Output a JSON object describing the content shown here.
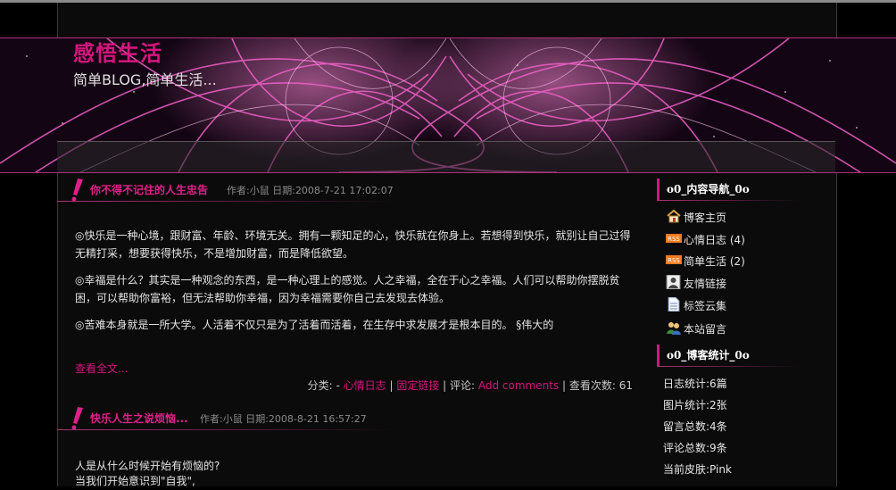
{
  "site": {
    "title": "感悟生活",
    "subtitle": "简单BLOG,简单生活..."
  },
  "posts": [
    {
      "title": "你不得不记住的人生忠告",
      "meta": "作者:小鼠 日期:2008-7-21 17:02:07",
      "paragraphs": [
        "◎快乐是一种心境，跟财富、年龄、环境无关。拥有一颗知足的心，快乐就在你身上。若想得到快乐，就别让自己过得无精打采，想要获得快乐，不是增加财富，而是降低欲望。",
        "◎幸福是什么？其实是一种观念的东西，是一种心理上的感觉。人之幸福，全在于心之幸福。人们可以帮助你摆脱贫困，可以帮助你富裕，但无法帮助你幸福，因为幸福需要你自己去发现去体验。",
        " ◎苦难本身就是一所大学。人活着不仅只是为了活着而活着，在生存中求发展才是根本目的。 §伟大的"
      ],
      "read_more": "查看全文...",
      "footer": {
        "category_label": "分类: - ",
        "category": "心情日志",
        "sep1": " | ",
        "permalink": "固定链接",
        "sep2": " | 评论: ",
        "comments": "Add comments",
        "views_label": " | 查看次数: ",
        "views": "61"
      }
    },
    {
      "title": "快乐人生之说烦恼...",
      "meta": "作者:小鼠 日期:2008-8-21 16:57:27",
      "paragraphs": [
        "人是从什么时候开始有烦恼的?",
        "当我们开始意识到\"自我\","
      ]
    }
  ],
  "sidebar": {
    "nav_title": "o0_内容导航_0o",
    "nav": [
      {
        "label": "博客主页",
        "icon": "home-icon"
      },
      {
        "label": "心情日志 (4)",
        "icon": "rss-icon"
      },
      {
        "label": "简单生活 (2)",
        "icon": "rss-icon"
      },
      {
        "label": "友情链接",
        "icon": "contact-icon"
      },
      {
        "label": "标签云集",
        "icon": "document-icon"
      },
      {
        "label": "本站留言",
        "icon": "users-icon"
      }
    ],
    "stats_title": "o0_博客统计_0o",
    "stats": [
      "日志统计:6篇",
      "图片统计:2张",
      "留言总数:4条",
      "评论总数:9条",
      "当前皮肤:Pink"
    ]
  },
  "colors": {
    "accent": "#d6157e",
    "background": "#000000",
    "panel": "#0b0b0b"
  }
}
